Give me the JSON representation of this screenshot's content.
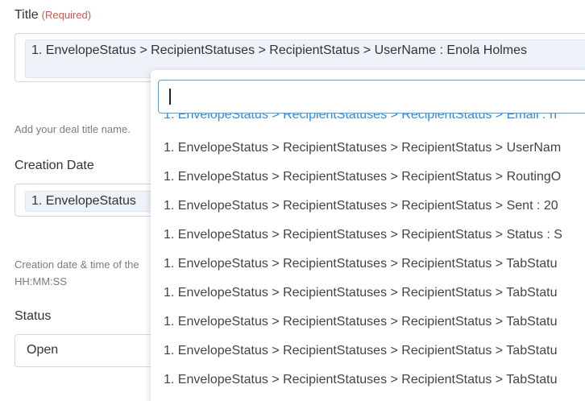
{
  "title_field": {
    "label": "Title",
    "required": "(Required)",
    "value": "1. EnvelopeStatus > RecipientStatuses > RecipientStatus > UserName : Enola Holmes",
    "help": "Add your deal title name."
  },
  "creation_date_field": {
    "label": "Creation Date",
    "value": "1. EnvelopeStatus",
    "help_line1": "Creation date & time of the",
    "help_line2": "HH:MM:SS"
  },
  "status_field": {
    "label": "Status",
    "value": "Open"
  },
  "dropdown": {
    "search_value": "",
    "items": [
      "1. EnvelopeStatus > RecipientStatuses > RecipientStatus > Email : h",
      "1. EnvelopeStatus > RecipientStatuses > RecipientStatus > UserNam",
      "1. EnvelopeStatus > RecipientStatuses > RecipientStatus > RoutingO",
      "1. EnvelopeStatus > RecipientStatuses > RecipientStatus > Sent : 20",
      "1. EnvelopeStatus > RecipientStatuses > RecipientStatus > Status : S",
      "1. EnvelopeStatus > RecipientStatuses > RecipientStatus > TabStatu",
      "1. EnvelopeStatus > RecipientStatuses > RecipientStatus > TabStatu",
      "1. EnvelopeStatus > RecipientStatuses > RecipientStatus > TabStatu",
      "1. EnvelopeStatus > RecipientStatuses > RecipientStatus > TabStatu",
      "1. EnvelopeStatus > RecipientStatuses > RecipientStatus > TabStatu"
    ]
  },
  "colors": {
    "required": "#d9534f",
    "highlight": "#2b8ce6",
    "focus_border": "#5b9de0",
    "token_bg": "#eef3fa"
  }
}
